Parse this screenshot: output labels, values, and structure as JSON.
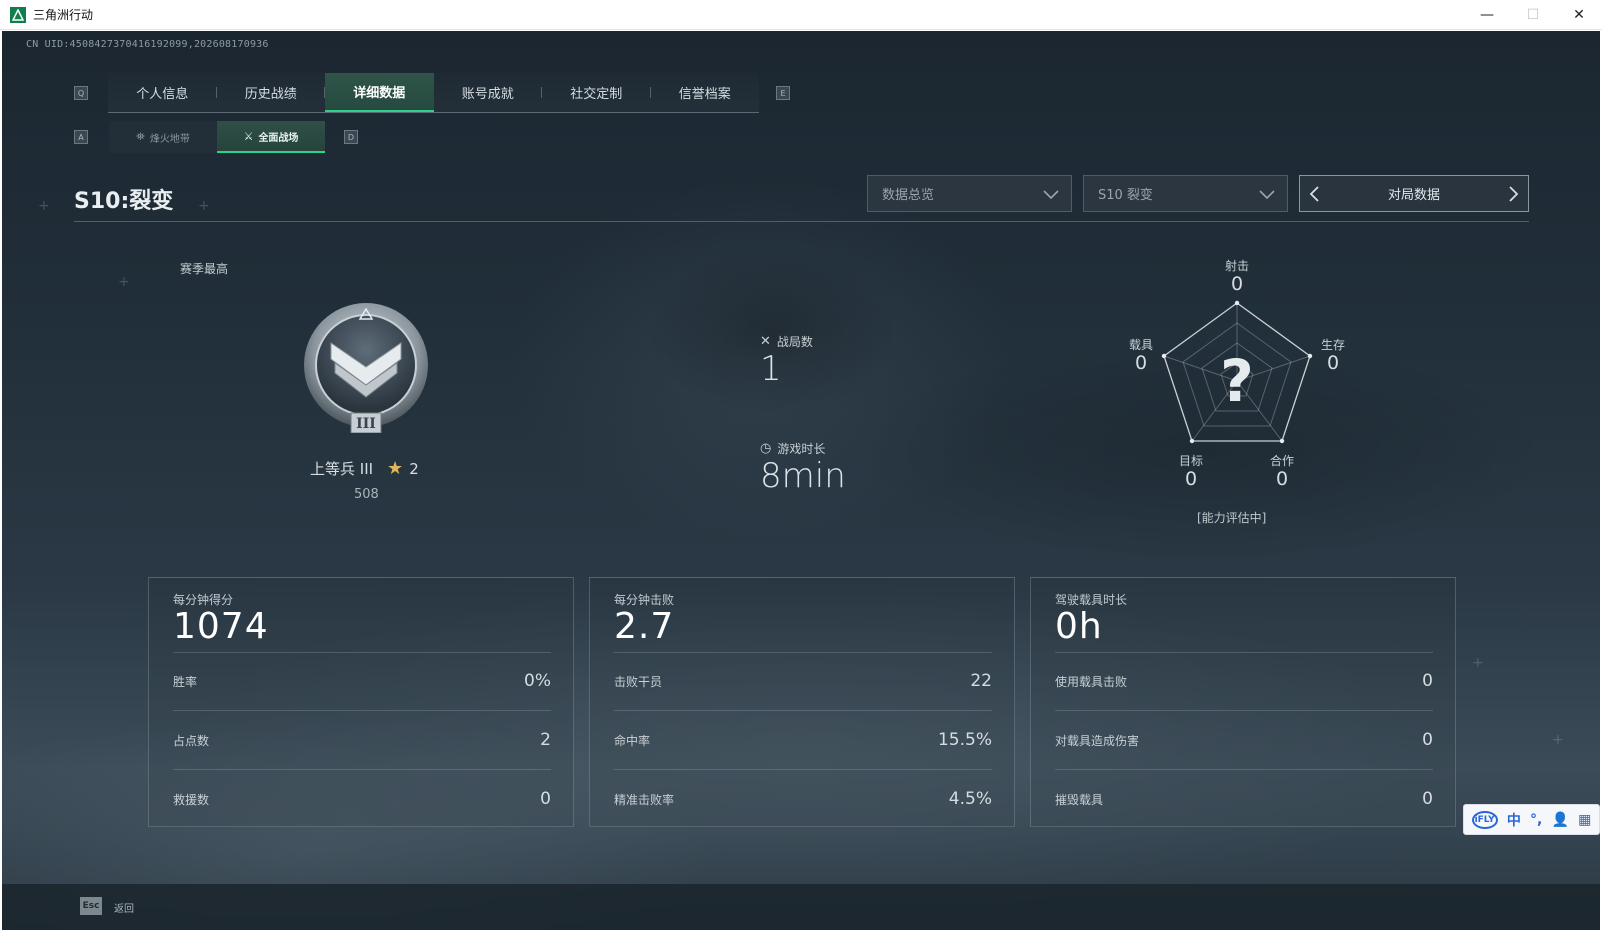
{
  "window": {
    "title": "三角洲行动",
    "minimize": "—",
    "maximize": "☐",
    "close": "✕"
  },
  "uid": "CN UID:4508427370416192099,202608170936",
  "tabs": {
    "prev_key": "Q",
    "next_key": "E",
    "items": [
      "个人信息",
      "历史战绩",
      "详细数据",
      "账号成就",
      "社交定制",
      "信誉档案"
    ],
    "active_index": 2
  },
  "subtabs": {
    "prev_key": "A",
    "next_key": "D",
    "items": [
      "烽火地带",
      "全面战场"
    ],
    "active_index": 1
  },
  "season": {
    "title": "S10:裂变"
  },
  "filters": {
    "overview": "数据总览",
    "season_select": "S10 裂变",
    "nav_label": "对局数据"
  },
  "rank": {
    "label": "赛季最高",
    "name": "上等兵 III",
    "stars": "2",
    "score": "508"
  },
  "center_stats": {
    "matches_label": "战局数",
    "matches_value": "1",
    "playtime_label": "游戏时长",
    "playtime_value": "8min"
  },
  "radar": {
    "shooting_label": "射击",
    "shooting_value": "0",
    "survival_label": "生存",
    "survival_value": "0",
    "teamwork_label": "合作",
    "teamwork_value": "0",
    "objective_label": "目标",
    "objective_value": "0",
    "vehicle_label": "载具",
    "vehicle_value": "0",
    "center_mark": "?",
    "status": "[能力评估中]"
  },
  "cards": [
    {
      "head_label": "每分钟得分",
      "head_value": "1074",
      "rows": [
        {
          "k": "胜率",
          "v": "0%"
        },
        {
          "k": "占点数",
          "v": "2"
        },
        {
          "k": "救援数",
          "v": "0"
        }
      ]
    },
    {
      "head_label": "每分钟击败",
      "head_value": "2.7",
      "rows": [
        {
          "k": "击败干员",
          "v": "22"
        },
        {
          "k": "命中率",
          "v": "15.5%"
        },
        {
          "k": "精准击败率",
          "v": "4.5%"
        }
      ]
    },
    {
      "head_label": "驾驶载具时长",
      "head_value": "0h",
      "rows": [
        {
          "k": "使用载具击败",
          "v": "0"
        },
        {
          "k": "对载具造成伤害",
          "v": "0"
        },
        {
          "k": "摧毁载具",
          "v": "0"
        }
      ]
    }
  ],
  "ime": {
    "logo": "iFLY",
    "lang": "中",
    "punct": "°,",
    "user": "👤",
    "apps": "▦"
  },
  "footer": {
    "esc_key": "Esc",
    "back_label": "返回"
  }
}
